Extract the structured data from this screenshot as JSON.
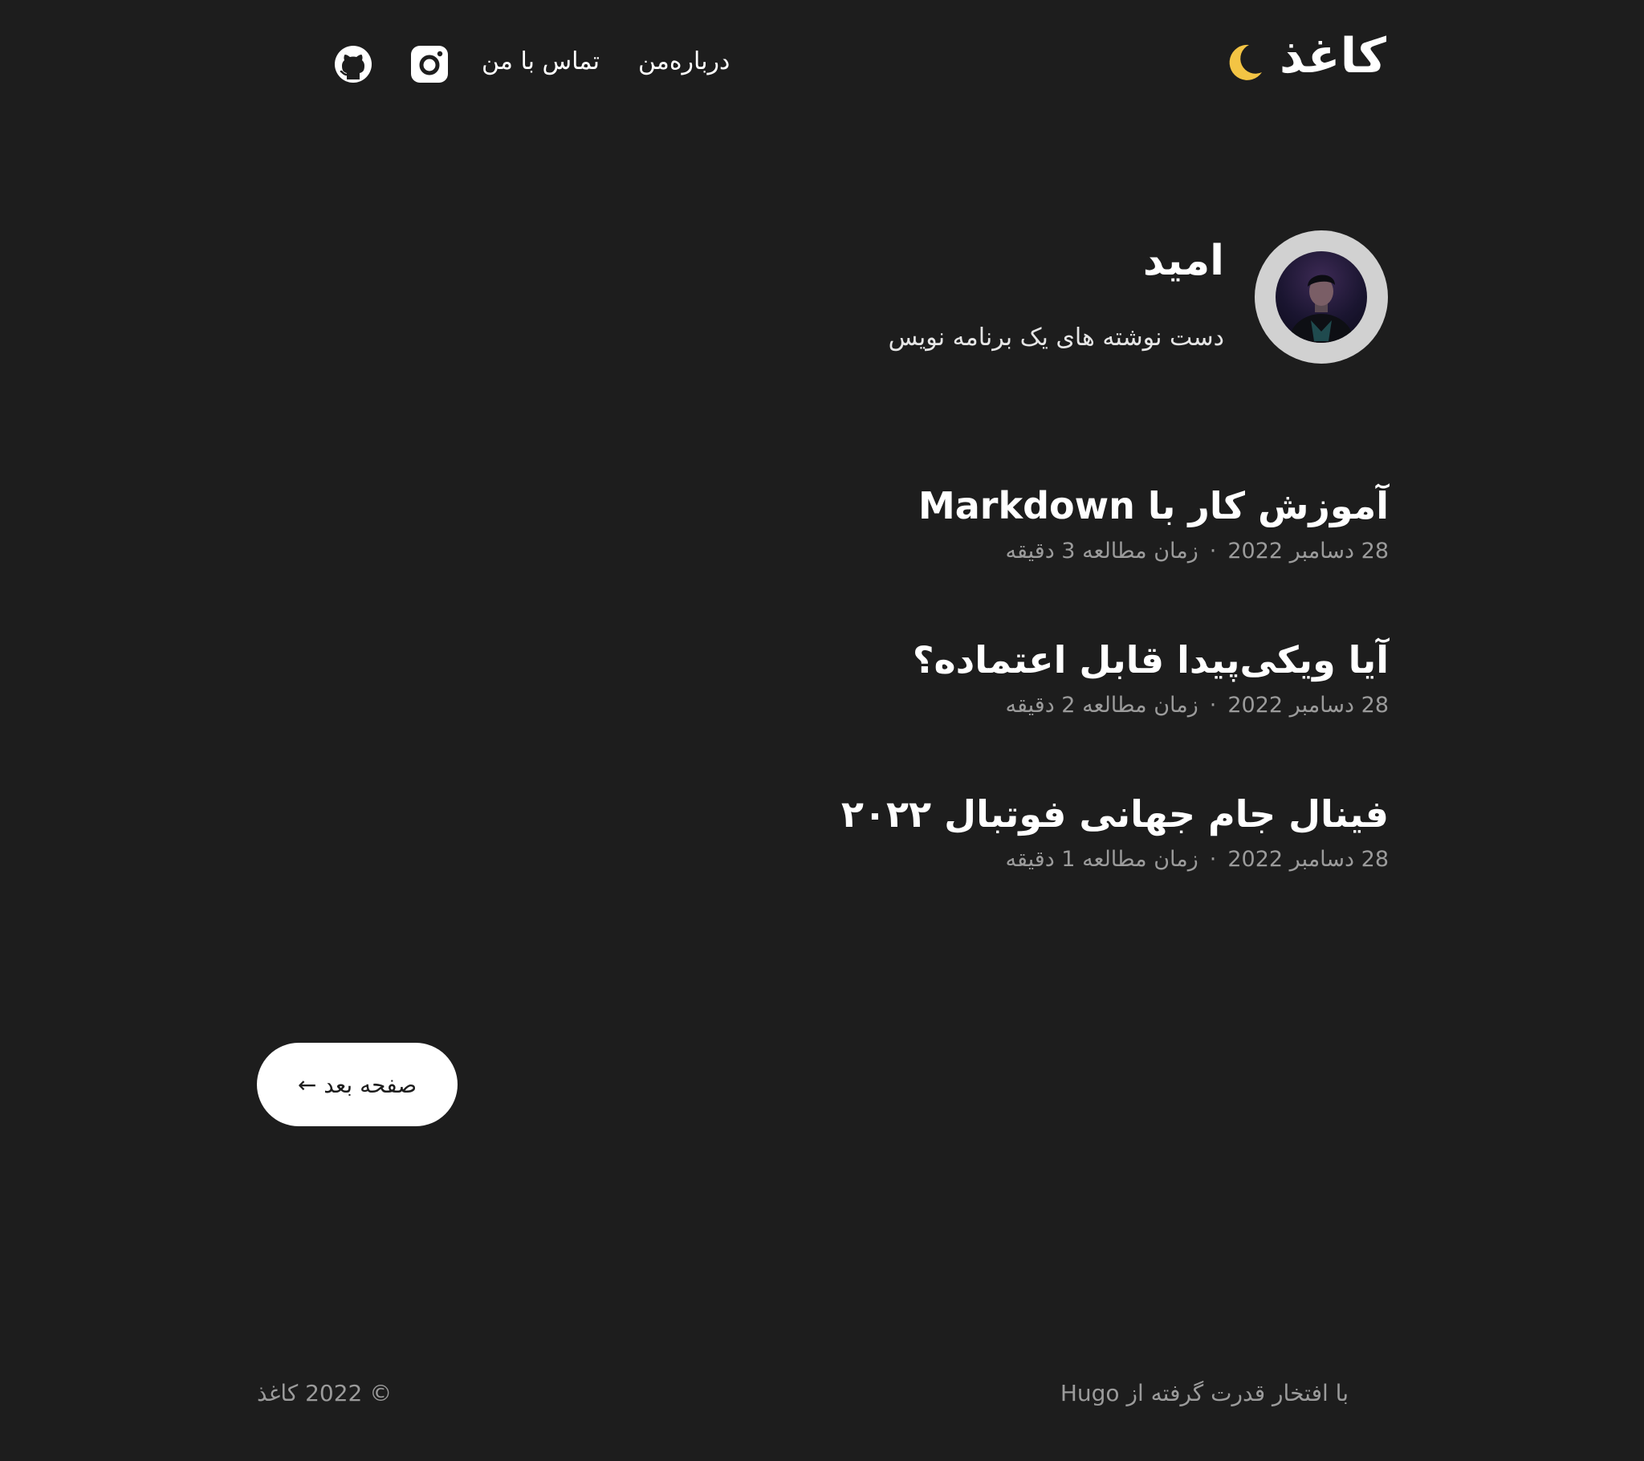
{
  "header": {
    "site_title": "کاغذ",
    "nav": [
      {
        "label": "درباره‌من"
      },
      {
        "label": "تماس با من"
      }
    ],
    "icons": {
      "theme_toggle": "moon-icon",
      "instagram": "instagram-icon",
      "github": "github-icon"
    }
  },
  "profile": {
    "name": "امید",
    "bio": "دست نوشته های یک برنامه نویس"
  },
  "posts": [
    {
      "title": "آموزش کار با Markdown",
      "date": "28 دسامبر 2022",
      "reading_time": "زمان مطالعه 3 دقیقه"
    },
    {
      "title": "آیا ویکی‌پیدا قابل اعتماده؟",
      "date": "28 دسامبر 2022",
      "reading_time": "زمان مطالعه 2 دقیقه"
    },
    {
      "title": "فینال جام جهانی فوتبال ۲۰۲۲",
      "date": "28 دسامبر 2022",
      "reading_time": "زمان مطالعه 1 دقیقه"
    }
  ],
  "meta_separator": "·",
  "pagination": {
    "next_label": "صفحه بعد ←"
  },
  "footer": {
    "copyright": "© 2022 کاغذ",
    "powered_prefix": "با افتخار قدرت گرفته از",
    "powered_link": "Hugo"
  },
  "colors": {
    "background": "#1d1d1d",
    "text": "#ffffff",
    "muted": "#9b9b9b",
    "moon": "#f3c444",
    "avatar_ring": "#d1d1d1"
  }
}
